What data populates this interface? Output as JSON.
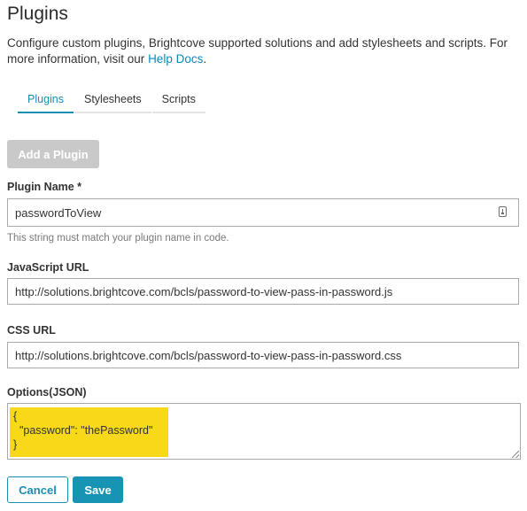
{
  "page": {
    "title": "Plugins",
    "intro_text": "Configure custom plugins, Brightcove supported solutions and add stylesheets and scripts. For more information, visit our ",
    "intro_link": "Help Docs",
    "intro_end": "."
  },
  "tabs": [
    {
      "label": "Plugins",
      "active": true
    },
    {
      "label": "Stylesheets",
      "active": false
    },
    {
      "label": "Scripts",
      "active": false
    }
  ],
  "add_button": {
    "label": "Add a Plugin",
    "enabled": false
  },
  "form": {
    "plugin_name": {
      "label": "Plugin Name *",
      "value": "passwordToView",
      "hint": "This string must match your plugin name in code.",
      "icon": "contact-card-icon"
    },
    "js_url": {
      "label": "JavaScript URL",
      "value": "http://solutions.brightcove.com/bcls/password-to-view-pass-in-password.js"
    },
    "css_url": {
      "label": "CSS URL",
      "value": "http://solutions.brightcove.com/bcls/password-to-view-pass-in-password.css"
    },
    "options": {
      "label": "Options(JSON)",
      "value": "{\n  \"password\": \"thePassword\"\n}",
      "highlight_color": "#f7d91a"
    }
  },
  "actions": {
    "cancel_label": "Cancel",
    "save_label": "Save"
  },
  "colors": {
    "accent": "#1a8eb0",
    "disabled_button": "#c9c9c9"
  }
}
